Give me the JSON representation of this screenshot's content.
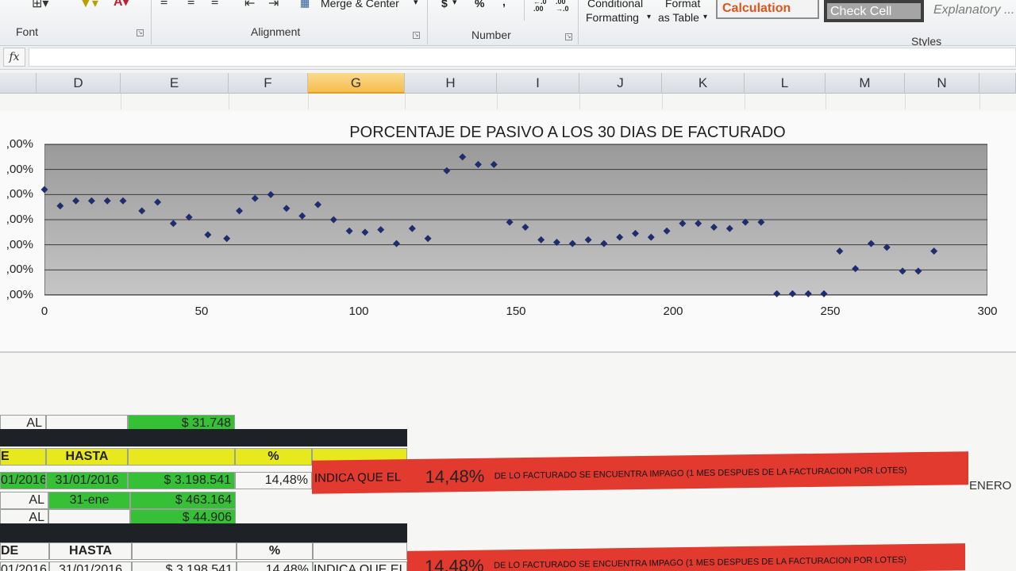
{
  "ribbon": {
    "groups": {
      "font": "Font",
      "alignment": "Alignment",
      "number": "Number",
      "styles": "Styles"
    },
    "merge_center": "Merge & Center",
    "currency": "$",
    "percent": "%",
    "comma": ",",
    "increase_decimal": "←.0 .00",
    "decrease_decimal": ".00 →.0",
    "conditional_formatting_1": "Conditional",
    "conditional_formatting_2": "Formatting",
    "format_table_1": "Format",
    "format_table_2": "as Table",
    "style_calculation": "Calculation",
    "style_check_cell": "Check Cell",
    "style_explanatory": "Explanatory ..."
  },
  "formula_bar": {
    "fx": "fx",
    "value": ""
  },
  "columns": [
    "D",
    "E",
    "F",
    "G",
    "H",
    "I",
    "J",
    "K",
    "L",
    "M",
    "N"
  ],
  "selected_column": "G",
  "chart_data": {
    "type": "scatter",
    "title": "PORCENTAJE DE PASIVO A LOS 30 DIAS DE FACTURADO",
    "y_tick_labels": [
      ",00%",
      ",00%",
      ",00%",
      ",00%",
      ",00%",
      ",00%",
      ",00%"
    ],
    "y_tick_count": 7,
    "xlim": [
      0,
      300
    ],
    "x_ticks": [
      0,
      50,
      100,
      150,
      200,
      250,
      300
    ],
    "marker_color": "#1f2d6e",
    "grid": true,
    "points": [
      [
        0,
        4.2
      ],
      [
        5,
        3.55
      ],
      [
        10,
        3.75
      ],
      [
        15,
        3.75
      ],
      [
        20,
        3.75
      ],
      [
        25,
        3.75
      ],
      [
        31,
        3.35
      ],
      [
        36,
        3.7
      ],
      [
        41,
        2.85
      ],
      [
        46,
        3.1
      ],
      [
        52,
        2.4
      ],
      [
        58,
        2.25
      ],
      [
        62,
        3.35
      ],
      [
        67,
        3.85
      ],
      [
        72,
        4.0
      ],
      [
        77,
        3.45
      ],
      [
        82,
        3.15
      ],
      [
        87,
        3.6
      ],
      [
        92,
        3.0
      ],
      [
        97,
        2.55
      ],
      [
        102,
        2.5
      ],
      [
        107,
        2.6
      ],
      [
        112,
        2.05
      ],
      [
        117,
        2.65
      ],
      [
        122,
        2.25
      ],
      [
        128,
        4.95
      ],
      [
        133,
        5.5
      ],
      [
        138,
        5.2
      ],
      [
        143,
        5.2
      ],
      [
        148,
        2.9
      ],
      [
        153,
        2.7
      ],
      [
        158,
        2.2
      ],
      [
        163,
        2.1
      ],
      [
        168,
        2.05
      ],
      [
        173,
        2.2
      ],
      [
        178,
        2.05
      ],
      [
        183,
        2.3
      ],
      [
        188,
        2.45
      ],
      [
        193,
        2.3
      ],
      [
        198,
        2.55
      ],
      [
        203,
        2.85
      ],
      [
        208,
        2.85
      ],
      [
        213,
        2.7
      ],
      [
        218,
        2.65
      ],
      [
        223,
        2.9
      ],
      [
        228,
        2.9
      ],
      [
        233,
        0.05
      ],
      [
        238,
        0.05
      ],
      [
        243,
        0.05
      ],
      [
        248,
        0.05
      ],
      [
        253,
        1.75
      ],
      [
        258,
        1.05
      ],
      [
        263,
        2.05
      ],
      [
        268,
        1.9
      ],
      [
        273,
        0.95
      ],
      [
        278,
        0.95
      ],
      [
        283,
        1.75
      ]
    ]
  },
  "table": {
    "r1_label": "AL",
    "r1_value": "$ 31.748",
    "hdr_desde": "E",
    "hdr_hasta": "HASTA",
    "hdr_pct": "%",
    "r3_desde": "01/2016",
    "r3_hasta": "31/01/2016",
    "r3_value": "$ 3.198.541",
    "r3_pct": "14,48%",
    "r3_indica": "INDICA QUE EL",
    "r4_label": "AL",
    "r4_hasta": "31-ene",
    "r4_value": "$ 463.164",
    "r5_label": "AL",
    "r5_value": "$ 44.906",
    "hdr2_desde": "DE",
    "hdr2_hasta": "HASTA",
    "hdr2_pct": "%",
    "r7_desde": "01/2016",
    "r7_hasta": "31/01/2016",
    "r7_value": "$ 3.198.541",
    "r7_pct": "14,48%",
    "r7_indica": "INDICA QUE EL",
    "red_big": "14,48%",
    "red_text": "DE LO FACTURADO SE ENCUENTRA IMPAGO (1 MES DESPUES DE LA FACTURACION POR LOTES)",
    "enero": "ENERO"
  }
}
